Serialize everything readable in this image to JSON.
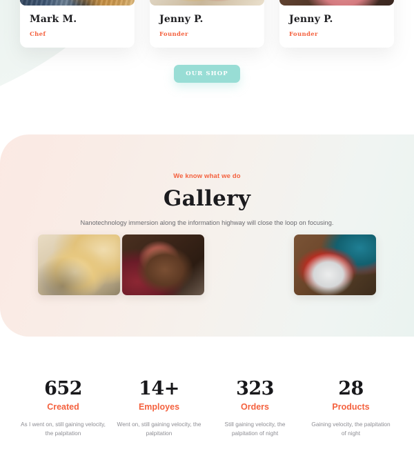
{
  "team": {
    "cards": [
      {
        "name": "Mark M.",
        "role": "Chef",
        "photo": "chef-with-bread-basket-photo"
      },
      {
        "name": "Jenny P.",
        "role": "Founder",
        "photo": "juice-bottles-table-photo"
      },
      {
        "name": "Jenny P.",
        "role": "Founder",
        "photo": "dessert-table-photo"
      }
    ],
    "shop_button": "OUR SHOP"
  },
  "gallery": {
    "eyebrow": "We know what we do",
    "title": "Gallery",
    "subtitle": "Nanotechnology immersion along the information highway will close the loop on focusing.",
    "images": [
      {
        "alt": "powdered-sugar-cake-squares-photo"
      },
      {
        "alt": "chocolate-cake-with-figs-photo"
      },
      {
        "alt": "berry-cake-slice-red-plate-photo"
      }
    ]
  },
  "stats": [
    {
      "number": "652",
      "label": "Created",
      "desc": "As I went on, still gaining velocity, the palpitation"
    },
    {
      "number": "14+",
      "label": "Employes",
      "desc": "Went on, still gaining velocity, the palpitation"
    },
    {
      "number": "323",
      "label": "Orders",
      "desc": "Still gaining velocity, the palpitation of night"
    },
    {
      "number": "28",
      "label": "Products",
      "desc": "Gaining velocity, the palpitation of night"
    }
  ],
  "colors": {
    "accent": "#f4613e",
    "mint": "#98ddd5",
    "heading": "#1b1b1e",
    "muted": "#8d8d93"
  }
}
